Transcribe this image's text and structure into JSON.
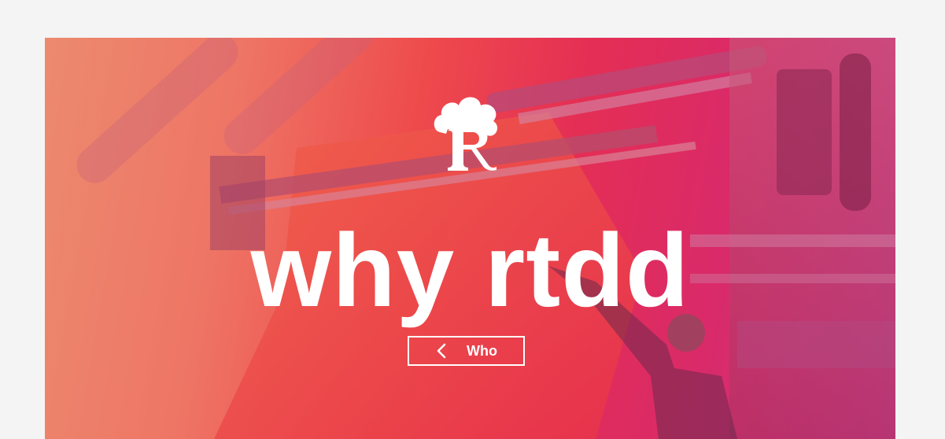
{
  "hero": {
    "title": "why rtdd",
    "logo_icon": "rtdd-r-cloud-logo-icon",
    "background_gradient": [
      "#ec8a6e",
      "#ee4a4c",
      "#e42e55",
      "#c83b8d"
    ]
  },
  "who_button": {
    "label": "Who",
    "icon": "chevron-left-icon"
  },
  "colors": {
    "page_background": "#f4f4f4",
    "text": "#ffffff"
  }
}
